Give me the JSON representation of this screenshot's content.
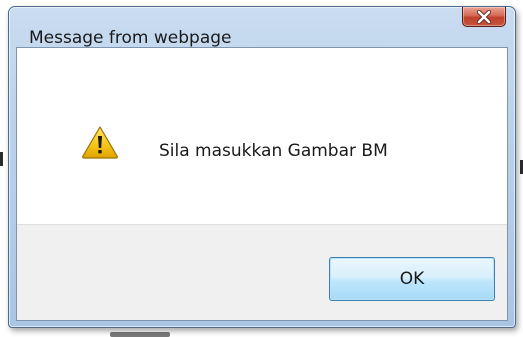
{
  "dialog": {
    "title": "Message from webpage",
    "message": "Sila masukkan Gambar BM",
    "ok_label": "OK",
    "close_icon": "close-icon",
    "message_icon": "warning-icon"
  },
  "colors": {
    "title_bar": "#b9d0ea",
    "close_button": "#c7563f",
    "content_background": "#ffffff",
    "button_area_background": "#f0f0f0",
    "ok_button_border": "#3c7fb1",
    "warning_yellow": "#f5c518"
  }
}
